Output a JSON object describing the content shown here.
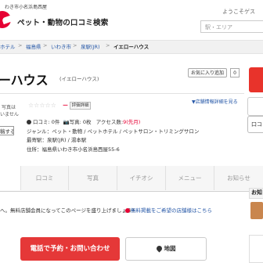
{
  "header": {
    "location_line": "わき市小名浜島西屋",
    "site_title": "ペット・動物の口コミ検索",
    "welcome": "ようこそゲス",
    "search_placeholder": "駅・エリア"
  },
  "breadcrumb": {
    "items": [
      "ホテル",
      "福島県",
      "いわき市",
      "泉駅(JR)"
    ],
    "separator": ">",
    "current": "イエローハウス"
  },
  "shop": {
    "title": "ーハウス",
    "kana": "(イエローハウス)",
    "favorite_label": "お気に入り追加",
    "favorite_count": "0",
    "rating_dash": "ー",
    "eval_label": "評価詳細",
    "detail_link": "▼店舗情報詳細を見る",
    "photo_note_1": "写真は",
    "photo_note_2": "いません",
    "post_label": "稿する",
    "reviews_label": "口コミ",
    "reviews_count": "0件",
    "photos_label": "写真",
    "photos_count": "0枚",
    "access_label": "アクセス数",
    "access_value": "9(先月)",
    "genre_label": "ジャンル",
    "genre_value": "ペット・動物 / ペットホテル / ペットサロン・トリミングサロン",
    "station_label": "最寄駅",
    "station_value": "泉駅(JR) / 湯本駅",
    "address_label": "住所",
    "address_value": "福島県いわき市小名浜島西屋55-6",
    "right_btn_label": "口コ"
  },
  "tabs": [
    {
      "label": ""
    },
    {
      "label": "口コミ"
    },
    {
      "label": "写真"
    },
    {
      "label": "イチオシ"
    },
    {
      "label": "メニュー"
    },
    {
      "label": "お知らせ"
    }
  ],
  "notice": {
    "text": "へ。無料店舗会員になってこのページを盛り上げましょう！",
    "link": "無料掲載をご希望の店舗様はこちら"
  },
  "side": {
    "label": "お知"
  },
  "buttons": {
    "call": "電話で予約・お問い合わせ",
    "map": "地図"
  },
  "colors": {
    "brand_red": "#e60033",
    "button_red": "#e53838",
    "link_blue": "#2557a7"
  }
}
